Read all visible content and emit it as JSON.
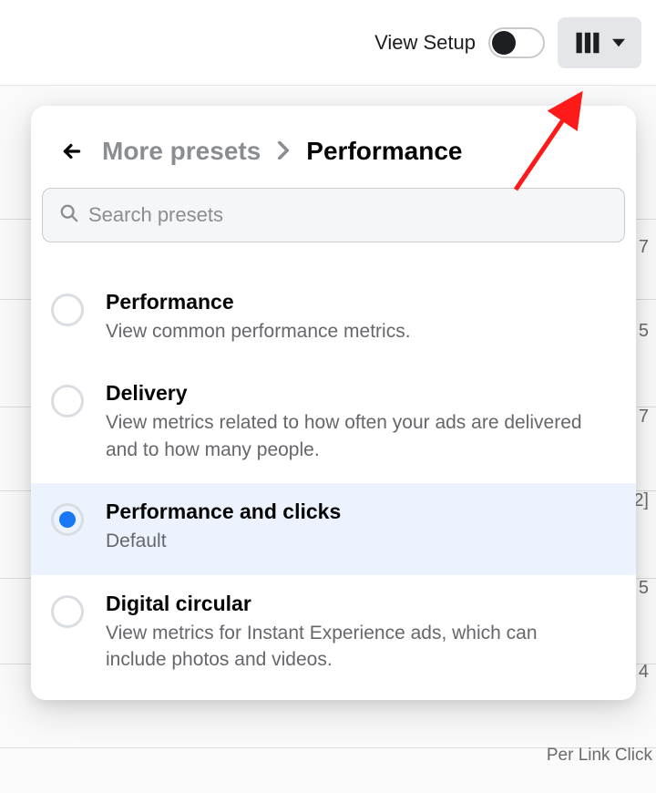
{
  "top": {
    "view_setup_label": "View Setup"
  },
  "breadcrumb": {
    "more": "More presets",
    "current": "Performance"
  },
  "search": {
    "placeholder": "Search presets"
  },
  "presets": [
    {
      "title": "Performance",
      "desc": "View common performance metrics.",
      "selected": false
    },
    {
      "title": "Delivery",
      "desc": "View metrics related to how often your ads are delivered and to how many people.",
      "selected": false
    },
    {
      "title": "Performance and clicks",
      "desc": "Default",
      "selected": true
    },
    {
      "title": "Digital circular",
      "desc": "View metrics for Instant Experience ads, which can include photos and videos.",
      "selected": false
    }
  ],
  "bg": {
    "values": [
      "7",
      "5",
      "7",
      "2]",
      "5",
      "4"
    ],
    "footer": "Per Link Click"
  }
}
